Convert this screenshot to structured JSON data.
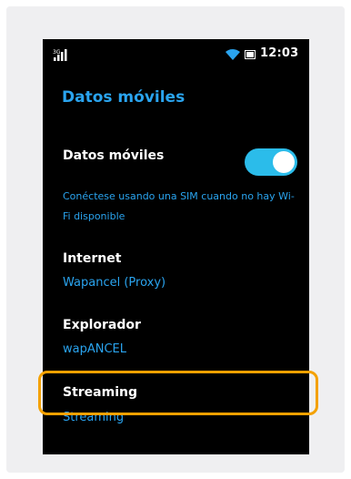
{
  "status_bar": {
    "signal_icon": "signal-icon",
    "wifi_icon": "wifi-icon",
    "battery_icon": "battery-icon",
    "time": "12:03"
  },
  "page": {
    "title": "Datos móviles"
  },
  "settings": {
    "mobile_data": {
      "label": "Datos móviles",
      "enabled": true,
      "description": "Conéctese usando una SIM cuando no hay Wi-Fi disponible"
    },
    "internet": {
      "label": "Internet",
      "value": "Wapancel (Proxy)"
    },
    "browser": {
      "label": "Explorador",
      "value": "wapANCEL"
    },
    "streaming": {
      "label": "Streaming",
      "value": "Streaming"
    }
  },
  "colors": {
    "accent": "#2aa4ef",
    "toggle_on": "#2bbcea",
    "highlight": "#f4a100",
    "screen_bg": "#000000"
  }
}
